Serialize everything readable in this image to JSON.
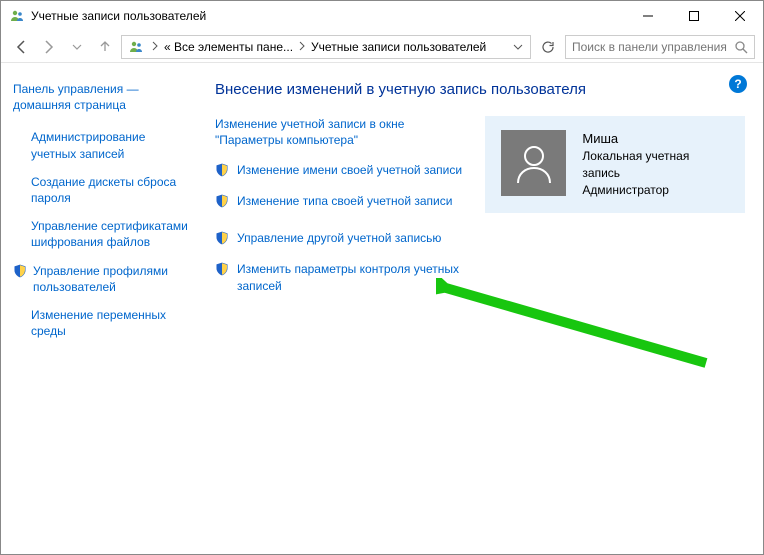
{
  "titlebar": {
    "text": "Учетные записи пользователей"
  },
  "addressbar": {
    "segment1": "« Все элементы пане...",
    "segment2": "Учетные записи пользователей"
  },
  "search": {
    "placeholder": "Поиск в панели управления"
  },
  "sidebar": {
    "home": "Панель управления — домашняя страница",
    "items": [
      {
        "label": "Администрирование учетных записей",
        "shield": false
      },
      {
        "label": "Создание дискеты сброса пароля",
        "shield": false
      },
      {
        "label": "Управление сертификатами шифрования файлов",
        "shield": false
      },
      {
        "label": "Управление профилями пользователей",
        "shield": true
      },
      {
        "label": "Изменение переменных среды",
        "shield": false
      }
    ]
  },
  "main": {
    "heading": "Внесение изменений в учетную запись пользователя",
    "actions_top": [
      {
        "label": "Изменение учетной записи в окне \"Параметры компьютера\"",
        "shield": false
      },
      {
        "label": "Изменение имени своей учетной записи",
        "shield": true
      },
      {
        "label": "Изменение типа своей учетной записи",
        "shield": true
      }
    ],
    "actions_bottom": [
      {
        "label": "Управление другой учетной записью",
        "shield": true
      },
      {
        "label": "Изменить параметры контроля учетных записей",
        "shield": true
      }
    ],
    "user": {
      "name": "Миша",
      "type": "Локальная учетная запись",
      "role": "Администратор"
    }
  },
  "help_glyph": "?"
}
